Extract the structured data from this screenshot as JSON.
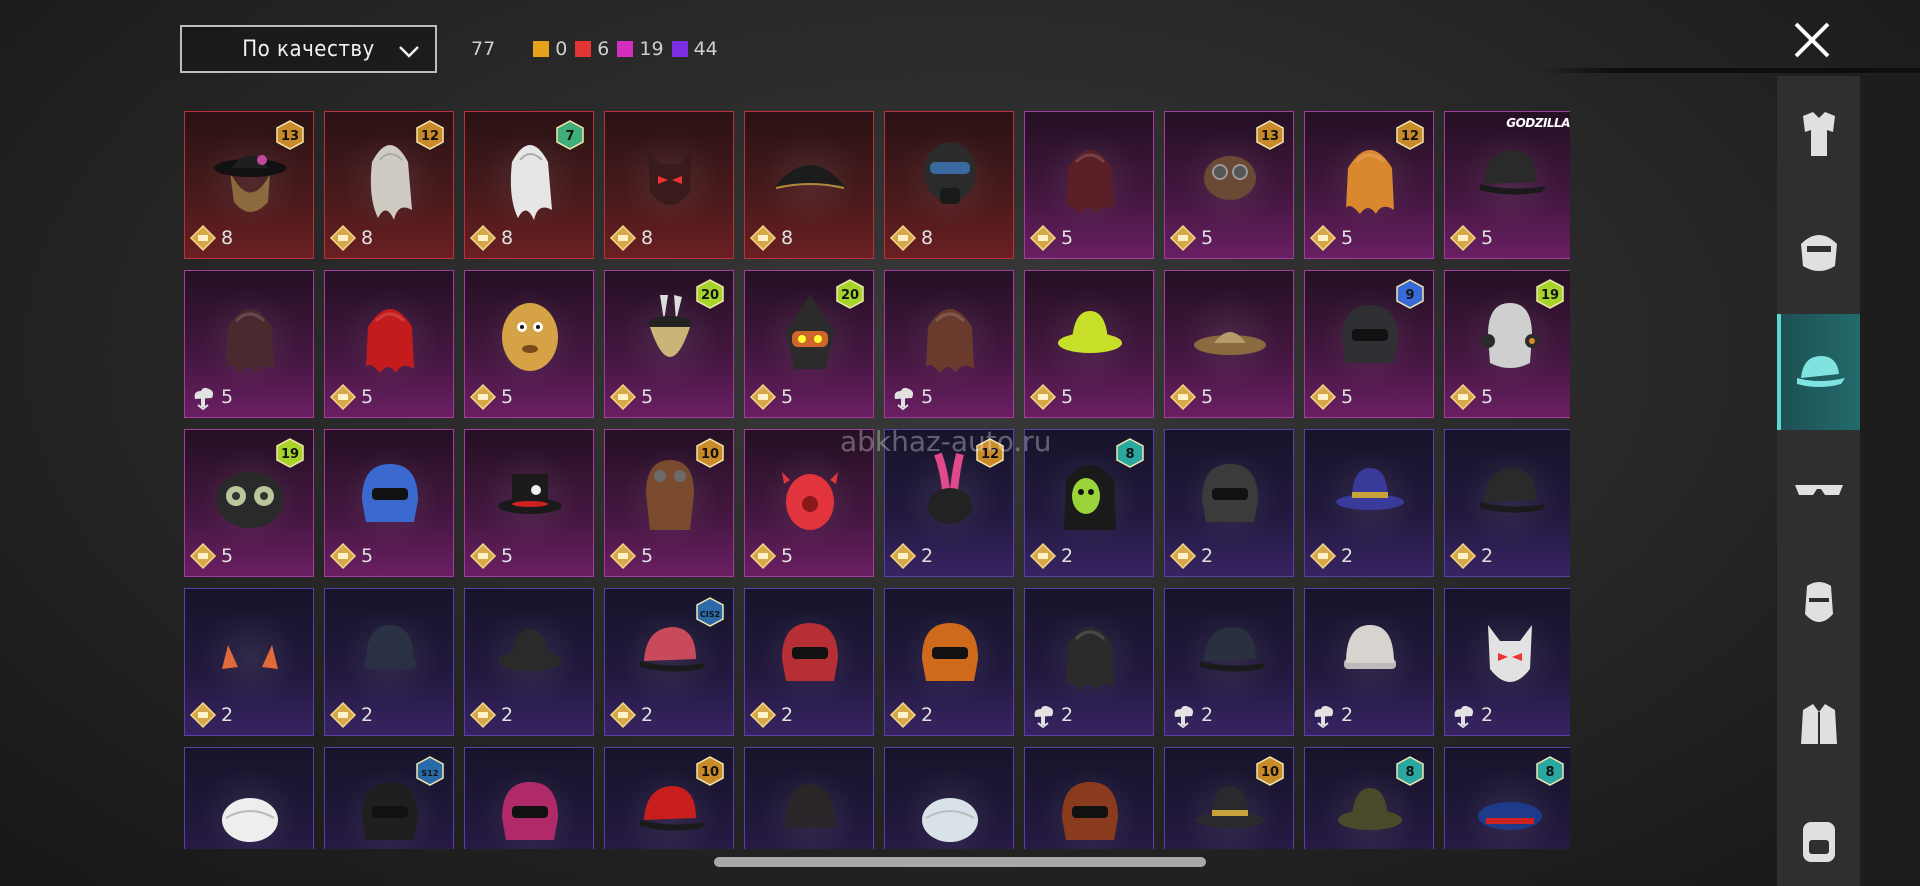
{
  "sort": {
    "label": "По качеству",
    "icon": "chevron-down-icon"
  },
  "counts": {
    "total": "77",
    "tiers": [
      {
        "color": "#e8a21a",
        "value": "0"
      },
      {
        "color": "#e23434",
        "value": "6"
      },
      {
        "color": "#d42ebf",
        "value": "19"
      },
      {
        "color": "#7b2fe0",
        "value": "44"
      }
    ]
  },
  "close_icon": "close-icon",
  "watermark": "abkhaz-auto.ru",
  "colors": {
    "accent": "#58d7d3",
    "tier_red": "#b8323a",
    "tier_pink": "#a33c9a",
    "tier_purple": "#5b3fa6"
  },
  "items": [
    {
      "tier": "red",
      "badge": "13",
      "price": "8",
      "currency": "gold",
      "art": "hat-with-hair",
      "fill": "#8b6a3e"
    },
    {
      "tier": "red",
      "badge": "12",
      "price": "8",
      "currency": "gold",
      "art": "white-hair",
      "fill": "#cfcac2"
    },
    {
      "tier": "red",
      "badge": "7",
      "price": "8",
      "currency": "gold",
      "art": "white-hair",
      "fill": "#e6e6e6"
    },
    {
      "tier": "red",
      "badge": "",
      "price": "8",
      "currency": "gold",
      "art": "demon-mask",
      "fill": "#3a1b1b"
    },
    {
      "tier": "red",
      "badge": "",
      "price": "8",
      "currency": "gold",
      "art": "pirate-hat",
      "fill": "#1c1c1c"
    },
    {
      "tier": "red",
      "badge": "",
      "price": "8",
      "currency": "gold",
      "art": "gas-mask",
      "fill": "#2b2b2b"
    },
    {
      "tier": "pink",
      "badge": "",
      "price": "5",
      "currency": "gold",
      "art": "hair",
      "fill": "#5b2027"
    },
    {
      "tier": "pink",
      "badge": "13",
      "price": "5",
      "currency": "gold",
      "art": "goggles",
      "fill": "#6a4a34"
    },
    {
      "tier": "pink",
      "badge": "12",
      "price": "5",
      "currency": "gold",
      "art": "hair",
      "fill": "#d9882e"
    },
    {
      "tier": "pink",
      "badge": "GODZILLA",
      "price": "5",
      "currency": "gold",
      "art": "cap",
      "fill": "#2a2a2a"
    },
    {
      "tier": "pink",
      "badge": "",
      "price": "5",
      "currency": "silver",
      "art": "hair",
      "fill": "#4a2a2e"
    },
    {
      "tier": "pink",
      "badge": "",
      "price": "5",
      "currency": "gold",
      "art": "hair",
      "fill": "#c41c1c"
    },
    {
      "tier": "pink",
      "badge": "",
      "price": "5",
      "currency": "gold",
      "art": "potato-head",
      "fill": "#d6a246"
    },
    {
      "tier": "pink",
      "badge": "20",
      "price": "5",
      "currency": "gold",
      "art": "bunny-hat",
      "fill": "#c9b577"
    },
    {
      "tier": "pink",
      "badge": "20",
      "price": "5",
      "currency": "gold",
      "art": "monkey-mask",
      "fill": "#2b2b2b"
    },
    {
      "tier": "pink",
      "badge": "",
      "price": "5",
      "currency": "silver",
      "art": "hair",
      "fill": "#6a3b2d"
    },
    {
      "tier": "pink",
      "badge": "",
      "price": "5",
      "currency": "gold",
      "art": "bucket-hat",
      "fill": "#c9e02a"
    },
    {
      "tier": "pink",
      "badge": "",
      "price": "5",
      "currency": "gold",
      "art": "straw-hat",
      "fill": "#8a6a3e"
    },
    {
      "tier": "pink",
      "badge": "9",
      "price": "5",
      "currency": "gold",
      "art": "helmet",
      "fill": "#2f2f34"
    },
    {
      "tier": "pink",
      "badge": "19",
      "price": "5",
      "currency": "gold",
      "art": "headphones",
      "fill": "#cfcfcf"
    },
    {
      "tier": "pink",
      "badge": "19",
      "price": "5",
      "currency": "gold",
      "art": "bug-helmet",
      "fill": "#2a2a2a"
    },
    {
      "tier": "pink",
      "badge": "",
      "price": "5",
      "currency": "gold",
      "art": "helmet",
      "fill": "#3a6ad0"
    },
    {
      "tier": "pink",
      "badge": "",
      "price": "5",
      "currency": "gold",
      "art": "top-hat",
      "fill": "#1a1a1a"
    },
    {
      "tier": "pink",
      "badge": "10",
      "price": "5",
      "currency": "gold",
      "art": "aviator-cap",
      "fill": "#7a4a2e"
    },
    {
      "tier": "pink",
      "badge": "",
      "price": "5",
      "currency": "gold",
      "art": "crab-mask",
      "fill": "#e2343c"
    },
    {
      "tier": "purple",
      "badge": "12",
      "price": "2",
      "currency": "gold",
      "art": "bunny-ears",
      "fill": "#e04a8a"
    },
    {
      "tier": "purple",
      "badge": "8",
      "price": "2",
      "currency": "gold",
      "art": "skull-hair",
      "fill": "#9ad43a"
    },
    {
      "tier": "purple",
      "badge": "",
      "price": "2",
      "currency": "gold",
      "art": "helmet",
      "fill": "#3b3b3b"
    },
    {
      "tier": "purple",
      "badge": "",
      "price": "2",
      "currency": "gold",
      "art": "hat",
      "fill": "#3a3a9a"
    },
    {
      "tier": "purple",
      "badge": "",
      "price": "2",
      "currency": "gold",
      "art": "cap",
      "fill": "#2a2a2a"
    },
    {
      "tier": "purple",
      "badge": "",
      "price": "2",
      "currency": "gold",
      "art": "horns",
      "fill": "#e06a3a"
    },
    {
      "tier": "purple",
      "badge": "",
      "price": "2",
      "currency": "gold",
      "art": "beanie",
      "fill": "#2a3144"
    },
    {
      "tier": "purple",
      "badge": "",
      "price": "2",
      "currency": "gold",
      "art": "bucket-hat",
      "fill": "#2a2a2a"
    },
    {
      "tier": "purple",
      "badge": "CIS2",
      "price": "2",
      "currency": "gold",
      "art": "cap",
      "fill": "#c94a5a"
    },
    {
      "tier": "purple",
      "badge": "",
      "price": "2",
      "currency": "gold",
      "art": "helmet",
      "fill": "#b52f35"
    },
    {
      "tier": "purple",
      "badge": "",
      "price": "2",
      "currency": "gold",
      "art": "helmet",
      "fill": "#cf6a1c"
    },
    {
      "tier": "purple",
      "badge": "",
      "price": "2",
      "currency": "silver",
      "art": "hair",
      "fill": "#2b2b2b"
    },
    {
      "tier": "purple",
      "badge": "",
      "price": "2",
      "currency": "silver",
      "art": "cap",
      "fill": "#2b3040"
    },
    {
      "tier": "purple",
      "badge": "",
      "price": "2",
      "currency": "silver",
      "art": "beanie",
      "fill": "#d7d4cf"
    },
    {
      "tier": "purple",
      "badge": "",
      "price": "2",
      "currency": "silver",
      "art": "demon-mask",
      "fill": "#e2e2e2"
    },
    {
      "tier": "purple",
      "badge": "",
      "price": "",
      "currency": "",
      "art": "turban",
      "fill": "#eeeeee"
    },
    {
      "tier": "purple",
      "badge": "S12",
      "price": "",
      "currency": "",
      "art": "helmet",
      "fill": "#1f1f1f"
    },
    {
      "tier": "purple",
      "badge": "",
      "price": "",
      "currency": "",
      "art": "helmet",
      "fill": "#b02a6a"
    },
    {
      "tier": "purple",
      "badge": "10",
      "price": "",
      "currency": "",
      "art": "cap",
      "fill": "#c81e1e"
    },
    {
      "tier": "purple",
      "badge": "",
      "price": "",
      "currency": "",
      "art": "beanie",
      "fill": "#2a2628"
    },
    {
      "tier": "purple",
      "badge": "",
      "price": "",
      "currency": "",
      "art": "turban",
      "fill": "#d8e2e8"
    },
    {
      "tier": "purple",
      "badge": "",
      "price": "",
      "currency": "",
      "art": "helmet",
      "fill": "#8a3b1e"
    },
    {
      "tier": "purple",
      "badge": "10",
      "price": "",
      "currency": "",
      "art": "hat",
      "fill": "#2a2a2e"
    },
    {
      "tier": "purple",
      "badge": "8",
      "price": "",
      "currency": "",
      "art": "bucket-hat",
      "fill": "#4a4a2a"
    },
    {
      "tier": "purple",
      "badge": "8",
      "price": "",
      "currency": "",
      "art": "beret",
      "fill": "#1e3a8a"
    }
  ],
  "sidebar": [
    {
      "name": "outfit-icon",
      "active": false
    },
    {
      "name": "mask-icon",
      "active": false
    },
    {
      "name": "cap-icon",
      "active": true
    },
    {
      "name": "glasses-icon",
      "active": false
    },
    {
      "name": "face-icon",
      "active": false
    },
    {
      "name": "jacket-icon",
      "active": false
    },
    {
      "name": "backpack-icon",
      "active": false
    }
  ]
}
